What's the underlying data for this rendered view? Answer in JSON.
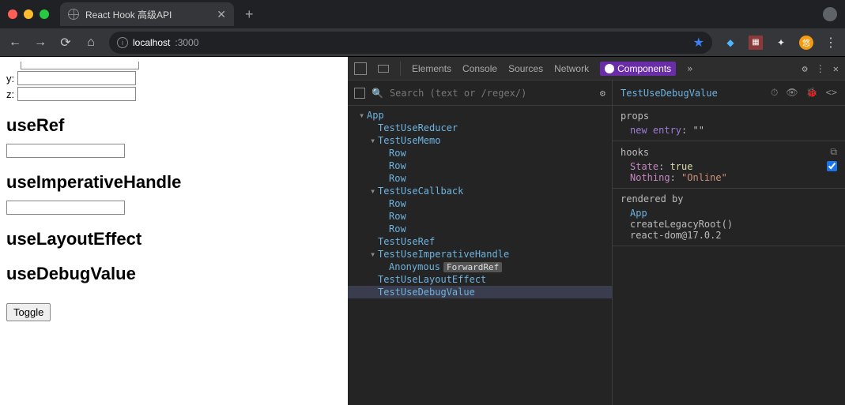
{
  "browser": {
    "tab_title": "React Hook 高级API",
    "new_tab": "+",
    "back": "←",
    "forward": "→",
    "reload": "⟳",
    "home": "⌂",
    "url_host": "localhost",
    "url_port": ":3000",
    "star": "★",
    "ext_diamond": "◆",
    "ext_puzzle": "✦",
    "ext_avatar": "悠",
    "kebab": "⋮"
  },
  "page": {
    "y_label": "y:",
    "z_label": "z:",
    "y_value": "",
    "z_value": "",
    "h_useRef": "useRef",
    "ref_value": "",
    "h_useImperativeHandle": "useImperativeHandle",
    "imp_value": "",
    "h_useLayoutEffect": "useLayoutEffect",
    "h_useDebugValue": "useDebugValue",
    "toggle_label": "Toggle"
  },
  "devtools": {
    "tabs": {
      "elements": "Elements",
      "console": "Console",
      "sources": "Sources",
      "network": "Network",
      "components": "Components",
      "more": "»",
      "gear": "⚙",
      "kebab": "⋮",
      "close": "✕"
    },
    "search_placeholder": "Search (text or /regex/)",
    "tree": {
      "app": "App",
      "testUseReducer": "TestUseReducer",
      "testUseMemo": "TestUseMemo",
      "row": "Row",
      "testUseCallback": "TestUseCallback",
      "testUseRef": "TestUseRef",
      "testUseImperativeHandle": "TestUseImperativeHandle",
      "anonymous": "Anonymous",
      "forwardRef": "ForwardRef",
      "testUseLayoutEffect": "TestUseLayoutEffect",
      "testUseDebugValue": "TestUseDebugValue"
    },
    "detail": {
      "selected": "TestUseDebugValue",
      "timer": "⏱",
      "eye": "👁",
      "bug": "🐞",
      "code": "<>",
      "props_title": "props",
      "new_entry_key": "new entry",
      "new_entry_val": "\"\"",
      "hooks_title": "hooks",
      "hooks_copy": "⧉",
      "state_key": "State",
      "state_val": "true",
      "state_checked": true,
      "nothing_key": "Nothing",
      "nothing_val": "\"Online\"",
      "rendered_title": "rendered by",
      "rendered_app": "App",
      "rendered_root": "createLegacyRoot()",
      "rendered_ver": "react-dom@17.0.2"
    }
  }
}
